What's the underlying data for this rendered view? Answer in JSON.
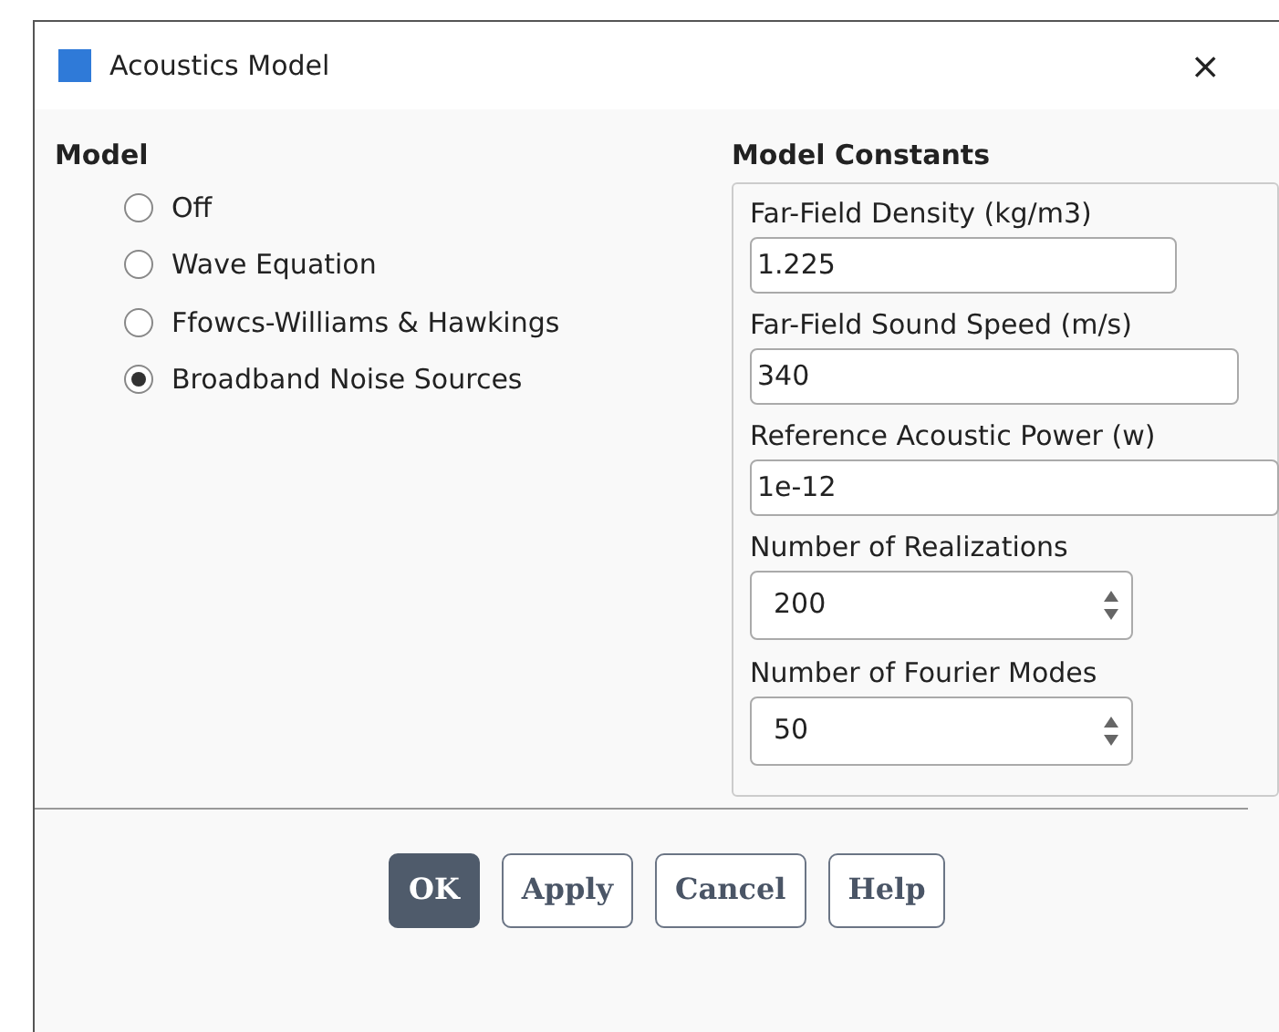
{
  "window": {
    "title": "Acoustics Model",
    "close": "×"
  },
  "model": {
    "heading": "Model",
    "options": [
      {
        "label": "Off",
        "selected": false
      },
      {
        "label": "Wave Equation",
        "selected": false
      },
      {
        "label": "Ffowcs-Williams & Hawkings",
        "selected": false
      },
      {
        "label": "Broadband Noise Sources",
        "selected": true
      }
    ]
  },
  "constants": {
    "heading": "Model Constants",
    "fields": [
      {
        "label": "Far-Field Density (kg/m3)",
        "value": "1.225",
        "kind": "text"
      },
      {
        "label": "Far-Field Sound Speed (m/s)",
        "value": "340",
        "kind": "text"
      },
      {
        "label": "Reference Acoustic Power (w)",
        "value": "1e-12",
        "kind": "text"
      },
      {
        "label": "Number of Realizations",
        "value": "200",
        "kind": "spinner"
      },
      {
        "label": "Number of Fourier Modes",
        "value": "50",
        "kind": "spinner"
      }
    ]
  },
  "buttons": [
    {
      "label": "OK",
      "kind": "primary"
    },
    {
      "label": "Apply",
      "kind": "normal"
    },
    {
      "label": "Cancel",
      "kind": "normal"
    },
    {
      "label": "Help",
      "kind": "normal"
    }
  ]
}
